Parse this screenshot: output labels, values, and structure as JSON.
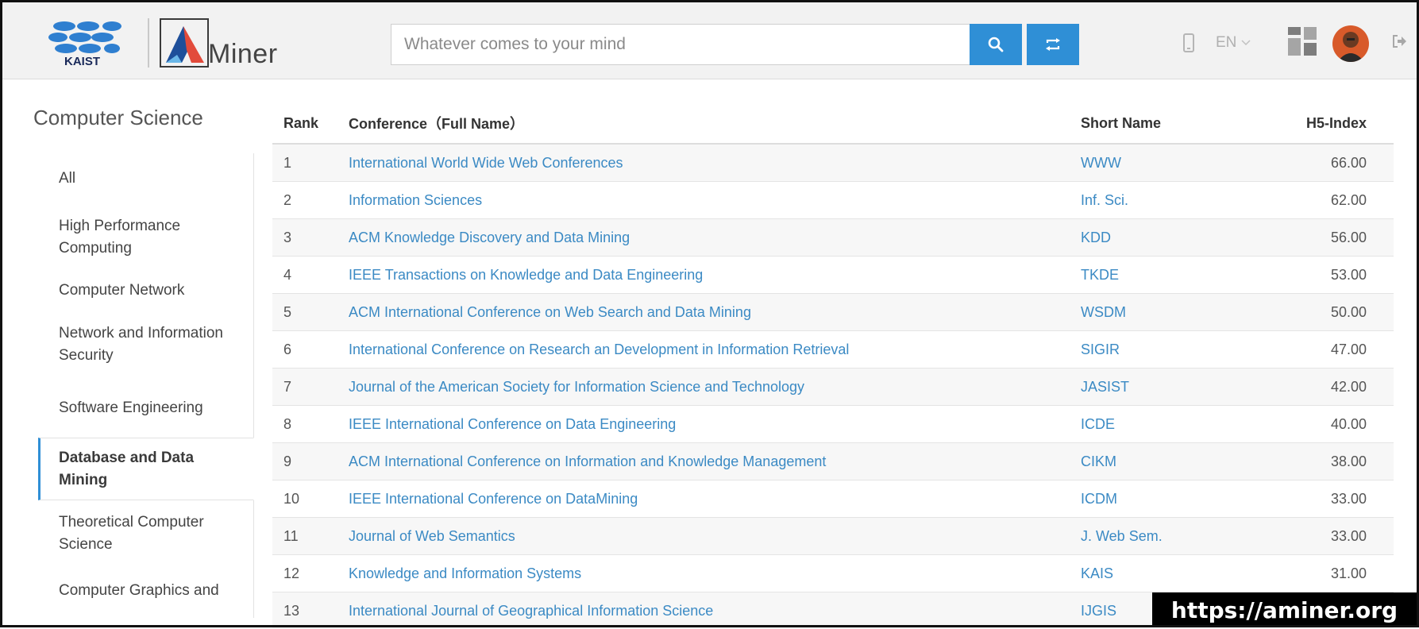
{
  "header": {
    "logo_left": "KAIST",
    "logo_right": "Miner",
    "search": {
      "placeholder": "Whatever comes to your mind"
    },
    "language": "EN",
    "colors": {
      "accent": "#2f8fd6"
    }
  },
  "sidebar": {
    "title": "Computer Science",
    "items": [
      {
        "label": "All",
        "active": false
      },
      {
        "label": "High Performance Computing",
        "active": false
      },
      {
        "label": "Computer Network",
        "active": false
      },
      {
        "label": "Network and Information Security",
        "active": false
      },
      {
        "label": "Software Engineering",
        "active": false
      },
      {
        "label": "Database and Data Mining",
        "active": true
      },
      {
        "label": "Theoretical Computer Science",
        "active": false
      },
      {
        "label": "Computer Graphics and",
        "active": false
      }
    ]
  },
  "table": {
    "columns": [
      "Rank",
      "Conference（Full Name）",
      "Short Name",
      "H5-Index"
    ],
    "rows": [
      {
        "rank": "1",
        "name": "International World Wide Web Conferences",
        "short": "WWW",
        "h5": "66.00"
      },
      {
        "rank": "2",
        "name": "Information Sciences",
        "short": "Inf. Sci.",
        "h5": "62.00"
      },
      {
        "rank": "3",
        "name": "ACM Knowledge Discovery and Data Mining",
        "short": "KDD",
        "h5": "56.00"
      },
      {
        "rank": "4",
        "name": "IEEE Transactions on Knowledge and Data Engineering",
        "short": "TKDE",
        "h5": "53.00"
      },
      {
        "rank": "5",
        "name": "ACM International Conference on Web Search and Data Mining",
        "short": "WSDM",
        "h5": "50.00"
      },
      {
        "rank": "6",
        "name": "International Conference on Research an Development in Information Retrieval",
        "short": "SIGIR",
        "h5": "47.00"
      },
      {
        "rank": "7",
        "name": "Journal of the American Society for Information Science and Technology",
        "short": "JASIST",
        "h5": "42.00"
      },
      {
        "rank": "8",
        "name": "IEEE International Conference on Data Engineering",
        "short": "ICDE",
        "h5": "40.00"
      },
      {
        "rank": "9",
        "name": "ACM International Conference on Information and Knowledge Management",
        "short": "CIKM",
        "h5": "38.00"
      },
      {
        "rank": "10",
        "name": "IEEE International Conference on DataMining",
        "short": "ICDM",
        "h5": "33.00"
      },
      {
        "rank": "11",
        "name": "Journal of Web Semantics",
        "short": "J. Web Sem.",
        "h5": "33.00"
      },
      {
        "rank": "12",
        "name": "Knowledge and Information Systems",
        "short": "KAIS",
        "h5": "31.00"
      },
      {
        "rank": "13",
        "name": "International Journal of Geographical Information Science",
        "short": "IJGIS",
        "h5": ""
      }
    ]
  },
  "watermark": "https://aminer.org"
}
